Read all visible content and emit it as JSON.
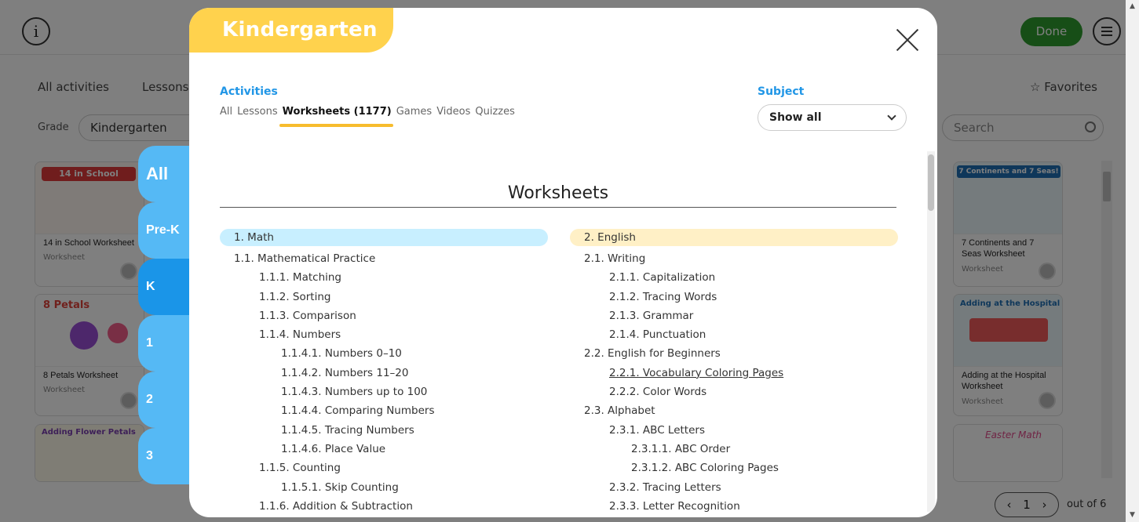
{
  "app": {
    "info_icon_glyph": "i",
    "done_label": "Done",
    "nav": [
      {
        "label": "All activities"
      },
      {
        "label": "Lessons"
      }
    ],
    "favorites_label": "Favorites",
    "grade_label": "Grade",
    "grade_value": "Kindergarten",
    "search_placeholder": "Search",
    "cards_left": [
      {
        "title": "14 in School Worksheet",
        "type": "Worksheet",
        "thumb_text": "14 in School"
      },
      {
        "title": "8 Petals Worksheet",
        "type": "Worksheet",
        "thumb_text": "8 Petals"
      },
      {
        "title": "",
        "type": "",
        "thumb_text": "Adding Flower Petals"
      }
    ],
    "cards_right": [
      {
        "title": "7 Continents and 7 Seas Worksheet",
        "type": "Worksheet",
        "thumb_text": "7 Continents and 7 Seas!"
      },
      {
        "title": "Adding at the Hospital Worksheet",
        "type": "Worksheet",
        "thumb_text": "Adding at the Hospital"
      },
      {
        "title": "",
        "type": "",
        "thumb_text": "Easter Math"
      }
    ],
    "pager": {
      "page": "1",
      "out_of_label": "out of 6"
    }
  },
  "grade_tabs": [
    {
      "label": "All",
      "active": false
    },
    {
      "label": "Pre-K",
      "active": false
    },
    {
      "label": "K",
      "active": true
    },
    {
      "label": "1",
      "active": false
    },
    {
      "label": "2",
      "active": false
    },
    {
      "label": "3",
      "active": false
    }
  ],
  "modal": {
    "title": "Kindergarten",
    "activities_label": "Activities",
    "filters": [
      {
        "label": "All",
        "active": false
      },
      {
        "label": "Lessons",
        "active": false
      },
      {
        "label": "Worksheets (1177)",
        "active": true
      },
      {
        "label": "Games",
        "active": false
      },
      {
        "label": "Videos",
        "active": false
      },
      {
        "label": "Quizzes",
        "active": false
      }
    ],
    "subject_label": "Subject",
    "subject_value": "Show all",
    "section_title": "Worksheets",
    "math": {
      "header": "1. Math",
      "header_color": "#c8efff",
      "items": [
        {
          "level": 2,
          "label": "1.1. Mathematical Practice"
        },
        {
          "level": 3,
          "label": "1.1.1. Matching"
        },
        {
          "level": 3,
          "label": "1.1.2. Sorting"
        },
        {
          "level": 3,
          "label": "1.1.3. Comparison"
        },
        {
          "level": 3,
          "label": "1.1.4. Numbers"
        },
        {
          "level": 4,
          "label": "1.1.4.1. Numbers 0–10"
        },
        {
          "level": 4,
          "label": "1.1.4.2. Numbers 11–20"
        },
        {
          "level": 4,
          "label": "1.1.4.3. Numbers up to 100"
        },
        {
          "level": 4,
          "label": "1.1.4.4. Comparing Numbers"
        },
        {
          "level": 4,
          "label": "1.1.4.5. Tracing Numbers"
        },
        {
          "level": 4,
          "label": "1.1.4.6. Place Value"
        },
        {
          "level": 3,
          "label": "1.1.5. Counting"
        },
        {
          "level": 4,
          "label": "1.1.5.1. Skip Counting"
        },
        {
          "level": 3,
          "label": "1.1.6. Addition & Subtraction"
        }
      ]
    },
    "english": {
      "header": "2. English",
      "header_color": "#fff0c6",
      "items": [
        {
          "level": 2,
          "label": "2.1. Writing"
        },
        {
          "level": 3,
          "label": "2.1.1. Capitalization"
        },
        {
          "level": 3,
          "label": "2.1.2. Tracing Words"
        },
        {
          "level": 3,
          "label": "2.1.3. Grammar"
        },
        {
          "level": 3,
          "label": "2.1.4. Punctuation"
        },
        {
          "level": 2,
          "label": "2.2. English for Beginners"
        },
        {
          "level": 3,
          "label": "2.2.1. Vocabulary Coloring Pages",
          "underline": true
        },
        {
          "level": 3,
          "label": "2.2.2. Color Words"
        },
        {
          "level": 2,
          "label": "2.3. Alphabet"
        },
        {
          "level": 3,
          "label": "2.3.1. ABC Letters"
        },
        {
          "level": 4,
          "label": "2.3.1.1. ABC Order"
        },
        {
          "level": 4,
          "label": "2.3.1.2. ABC Coloring Pages"
        },
        {
          "level": 3,
          "label": "2.3.2. Tracing Letters"
        },
        {
          "level": 3,
          "label": "2.3.3. Letter Recognition"
        }
      ]
    }
  },
  "colors": {
    "accent_blue": "#2196e6",
    "tab_blue": "#55b9f5",
    "tab_active": "#1a95e8",
    "title_yellow": "#ffd24d",
    "underline_yellow": "#f7bc2d",
    "done_green": "#2f9c2f"
  }
}
